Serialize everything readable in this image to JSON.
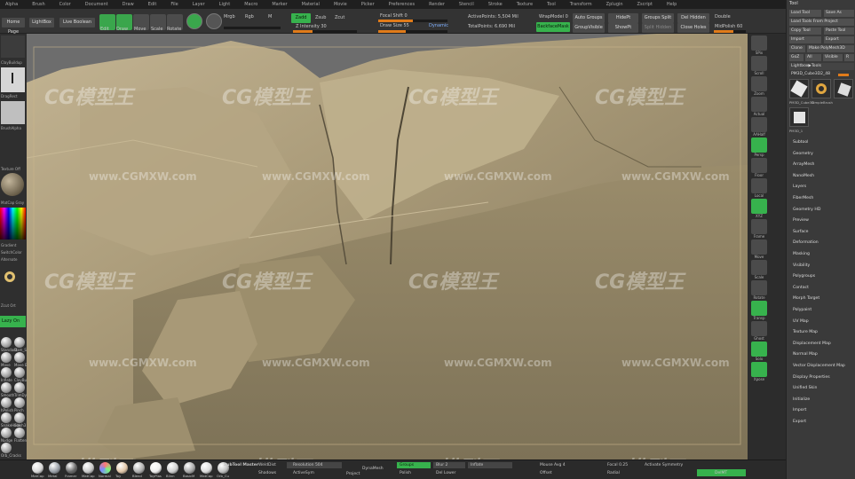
{
  "menubar": [
    "Alpha",
    "Brush",
    "Color",
    "Document",
    "Draw",
    "Edit",
    "File",
    "Layer",
    "Light",
    "Macro",
    "Marker",
    "Material",
    "Movie",
    "Picker",
    "Preferences",
    "Render",
    "Stencil",
    "Stroke",
    "Texture",
    "Tool",
    "Transform",
    "Zplugin",
    "Zscript",
    "Help"
  ],
  "toolbar": {
    "home_page": "Home Page",
    "lightbox": "LightBox",
    "live_boolean": "Live Boolean",
    "edit": "Edit",
    "draw": "Draw",
    "move": "Move",
    "scale": "Scale",
    "rotate": "Rotate",
    "mrgb": "Mrgb",
    "rgb": "Rgb",
    "m": "M",
    "rgb_intensity": "Rgb Intensity",
    "zadd": "Zadd",
    "zsub": "Zsub",
    "zcut": "Zcut",
    "z_intensity": "Z Intensity 30",
    "focal_shift": "Focal Shift 0",
    "draw_size": "Draw Size 55",
    "dynamic": "Dynamic",
    "active_points": "ActivePoints: 5,504 Mil",
    "total_points": "TotalPoints: 6.690 Mil",
    "wrapmodel": "WrapModel 0",
    "backface_mask": "BackfaceMask",
    "auto_groups": "Auto Groups",
    "group_visible": "GroupVisible",
    "hide_pt": "HidePt",
    "show_pt": "ShowPt",
    "groups_split": "Groups Split",
    "split_hidden": "Split Hidden",
    "del_hidden": "Del Hidden",
    "close_holes": "Close Holes",
    "double": "Double",
    "mid_polish": "MidPolish 60"
  },
  "leftshelf": {
    "brush_label": "ClayBuildup",
    "stroke_label": "DragRect",
    "alpha_label": "BrushAlpha",
    "texture_label": "Texture Off",
    "material_label": "MatCap Gray",
    "gradient_label": "Gradient",
    "switch_label": "SwitchColor",
    "alternate_label": "Alternate",
    "zsub_label": "Zcut Ort",
    "lazy_label": "Lazy On",
    "brushes": [
      "Standard",
      "Dam_Standard",
      "Move",
      "Move E",
      "Inflate",
      "ClayBuildup",
      "Smooth",
      "TrimDynamic",
      "hPolish",
      "Pinch",
      "SnakeHook",
      "Slash3",
      "Nudge",
      "Flatten",
      "Orb_Cracks"
    ]
  },
  "rightshelf": [
    "SPix",
    "Scroll",
    "Zoom",
    "Actual",
    "AAHalf",
    "Persp",
    "Floor",
    "Local",
    "XYZ",
    "Frame",
    "Move",
    "Scale",
    "Rotate",
    "Transp",
    "Ghost",
    "Solo",
    "Xpose"
  ],
  "toolpanel": {
    "title": "Tool",
    "load_tool": "Load Tool",
    "save_as": "Save As",
    "load_tools_from_project": "Load Tools From Project",
    "copy_tool": "Copy Tool",
    "paste_tool": "Paste Tool",
    "import": "Import",
    "export": "Export",
    "clone": "Clone",
    "make_polymesh": "Make PolyMesh3D",
    "goz": "GoZ",
    "all": "All",
    "visible": "Visible",
    "r": "R",
    "lightbox_tools": "Lightbox▶Tools",
    "current_tool": "PM3D_Cube3D2_48",
    "thumb_labels": [
      "PM3D_Cube3D",
      "SimpleBrush",
      "PM3D_Cube3D",
      "PM3D_1"
    ],
    "menu": [
      "Subtool",
      "Geometry",
      "ArrayMesh",
      "NanoMesh",
      "Layers",
      "FiberMesh",
      "Geometry HD",
      "Preview",
      "Surface",
      "Deformation",
      "Masking",
      "Visibility",
      "Polygroups",
      "Contact",
      "Morph Target",
      "Polypaint",
      "UV Map",
      "Texture Map",
      "Displacement Map",
      "Normal Map",
      "Vector Displacement Map",
      "Display Properties",
      "Unified Skin",
      "Initialize",
      "Import",
      "Export"
    ]
  },
  "bottombar": {
    "materials": [
      "MatCap",
      "Metal",
      "Framer",
      "MatCap",
      "Normal",
      "Toy",
      "Blend",
      "ToyPlas",
      "Blinn",
      "BasicM",
      "MatCap",
      "Orb_Cu"
    ],
    "subtool_master": "SubTool Master",
    "weld_dist": "WeldDist",
    "resolution": "Resolution 504",
    "symmetry": "Shadows",
    "active_sym": "ActiveSym",
    "dynamesh": "DynaMesh",
    "project": "Project",
    "groups": "Groups",
    "polish": "Polish",
    "blur": "Blur 2",
    "inflate": "Inflate",
    "mouse_avg": "Mouse Avg 4",
    "offset": "Offset",
    "del_lower": "Del Lower",
    "focal": "Focal 0.25",
    "activate_symmetry": "Activate Symmetry",
    "radial": "Radial",
    "delmt": "DelMT"
  },
  "watermarks": {
    "brand": "CG模型王",
    "url": "www.CGMXW.com",
    "short": "CG模型"
  },
  "colors": {
    "accent_green": "#37b24d",
    "accent_orange": "#e07b1a",
    "rock": "#a99a78"
  }
}
